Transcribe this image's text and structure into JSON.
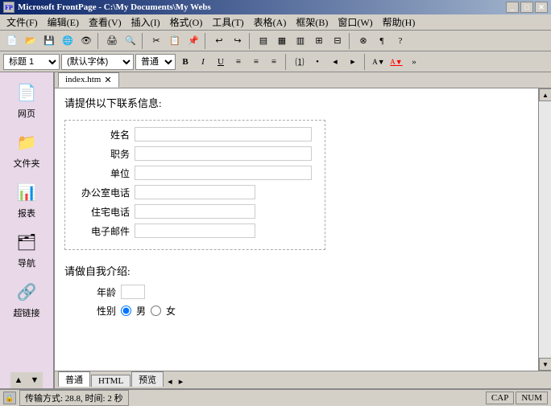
{
  "titlebar": {
    "title": "Microsoft FrontPage - C:\\My Documents\\My Webs",
    "icon": "FP"
  },
  "menu": {
    "items": [
      "文件(F)",
      "编辑(E)",
      "查看(V)",
      "插入(I)",
      "格式(O)",
      "工具(T)",
      "表格(A)",
      "框架(B)",
      "窗口(W)",
      "帮助(H)"
    ]
  },
  "format_bar": {
    "style_select": "标题 1",
    "font_select": "(默认字体)",
    "size_select": "普通",
    "bold": "B",
    "italic": "I",
    "underline": "U"
  },
  "sidebar": {
    "items": [
      {
        "label": "网页",
        "icon": "📄"
      },
      {
        "label": "文件夹",
        "icon": "📁"
      },
      {
        "label": "报表",
        "icon": "📊"
      },
      {
        "label": "导航",
        "icon": "🗂"
      },
      {
        "label": "超链接",
        "icon": "🔗"
      }
    ]
  },
  "tab": {
    "filename": "index.htm"
  },
  "page": {
    "title": "请提供以下联系信息:",
    "form_fields": [
      {
        "label": "姓名",
        "width": "long"
      },
      {
        "label": "职务",
        "width": "long"
      },
      {
        "label": "单位",
        "width": "long"
      },
      {
        "label": "办公室电话",
        "width": "medium"
      },
      {
        "label": "住宅电话",
        "width": "medium"
      },
      {
        "label": "电子邮件",
        "width": "medium"
      }
    ],
    "section2_title": "请做自我介绍:",
    "age_label": "年龄",
    "gender_label": "性别",
    "male_label": "男",
    "female_label": "女"
  },
  "bottom_tabs": {
    "tabs": [
      "普通",
      "HTML",
      "预览"
    ],
    "active": "普通"
  },
  "statusbar": {
    "transfer": "传输方式: 28.8, 时间: 2 秒",
    "cap": "CAP",
    "num": "NUM"
  }
}
